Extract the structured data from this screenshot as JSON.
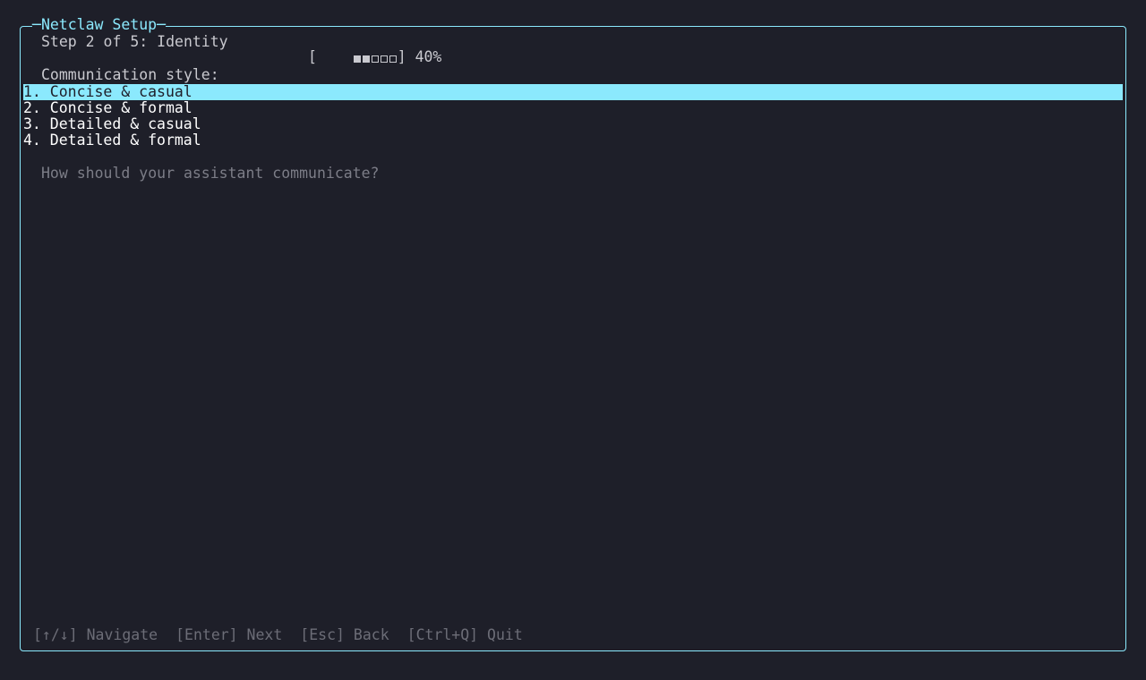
{
  "window": {
    "title": "Netclaw Setup",
    "accent_color": "#8be9fd",
    "background_color": "#1e1f29"
  },
  "wizard": {
    "step_text": "Step 2 of 5: Identity",
    "progress": {
      "open_bracket": "[",
      "close_bracket": "]",
      "filled_cells": 2,
      "total_cells": 5,
      "percent_text": "40%"
    },
    "section_label": "Communication style:",
    "options": [
      {
        "label": "1. Concise & casual",
        "selected": true
      },
      {
        "label": "2. Concise & formal",
        "selected": false
      },
      {
        "label": "3. Detailed & casual",
        "selected": false
      },
      {
        "label": "4. Detailed & formal",
        "selected": false
      }
    ],
    "hint": "How should your assistant communicate?"
  },
  "footer": {
    "navigate": "[↑/↓] Navigate",
    "next": "[Enter] Next",
    "back": "[Esc] Back",
    "quit": "[Ctrl+Q] Quit"
  }
}
